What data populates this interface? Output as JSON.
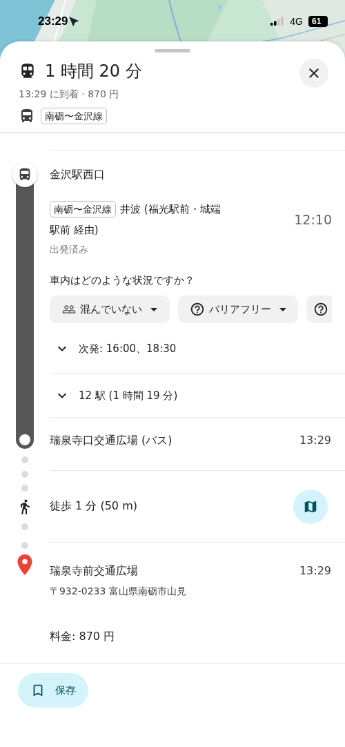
{
  "status_bar": {
    "time": "23:29",
    "network": "4G",
    "battery": "61"
  },
  "summary": {
    "duration": "1 時間 20 分",
    "arrival": "13:29 に到着 · 870 円",
    "line": "南砺〜金沢線"
  },
  "departure": {
    "stop": "金沢駅西口",
    "line": "南砺〜金沢線",
    "headsign": "井波 (福光駅前・城端駅前 経由)",
    "time": "12:10",
    "status": "出発済み",
    "question": "車内はどのような状況ですか？",
    "feedback": [
      {
        "kind": "crowding",
        "label": "混んでいない"
      },
      {
        "kind": "question",
        "label": "バリアフリー"
      },
      {
        "kind": "question"
      }
    ],
    "next_departures": {
      "text": "次発: 16:00、18:30",
      "expanded": false
    },
    "stops": {
      "text": "12 駅 (1 時間 19 分)",
      "expanded": false
    }
  },
  "arrival": {
    "stop": "瑞泉寺口交通広場 (バス)",
    "time": "13:29"
  },
  "walk": {
    "text": "徒歩 1 分 (50 m)"
  },
  "destination": {
    "name": "瑞泉寺前交通広場",
    "time": "13:29",
    "address": "〒932-0233 富山県南砺市山見",
    "fare": "料金: 870 円"
  },
  "save_button": "保存"
}
